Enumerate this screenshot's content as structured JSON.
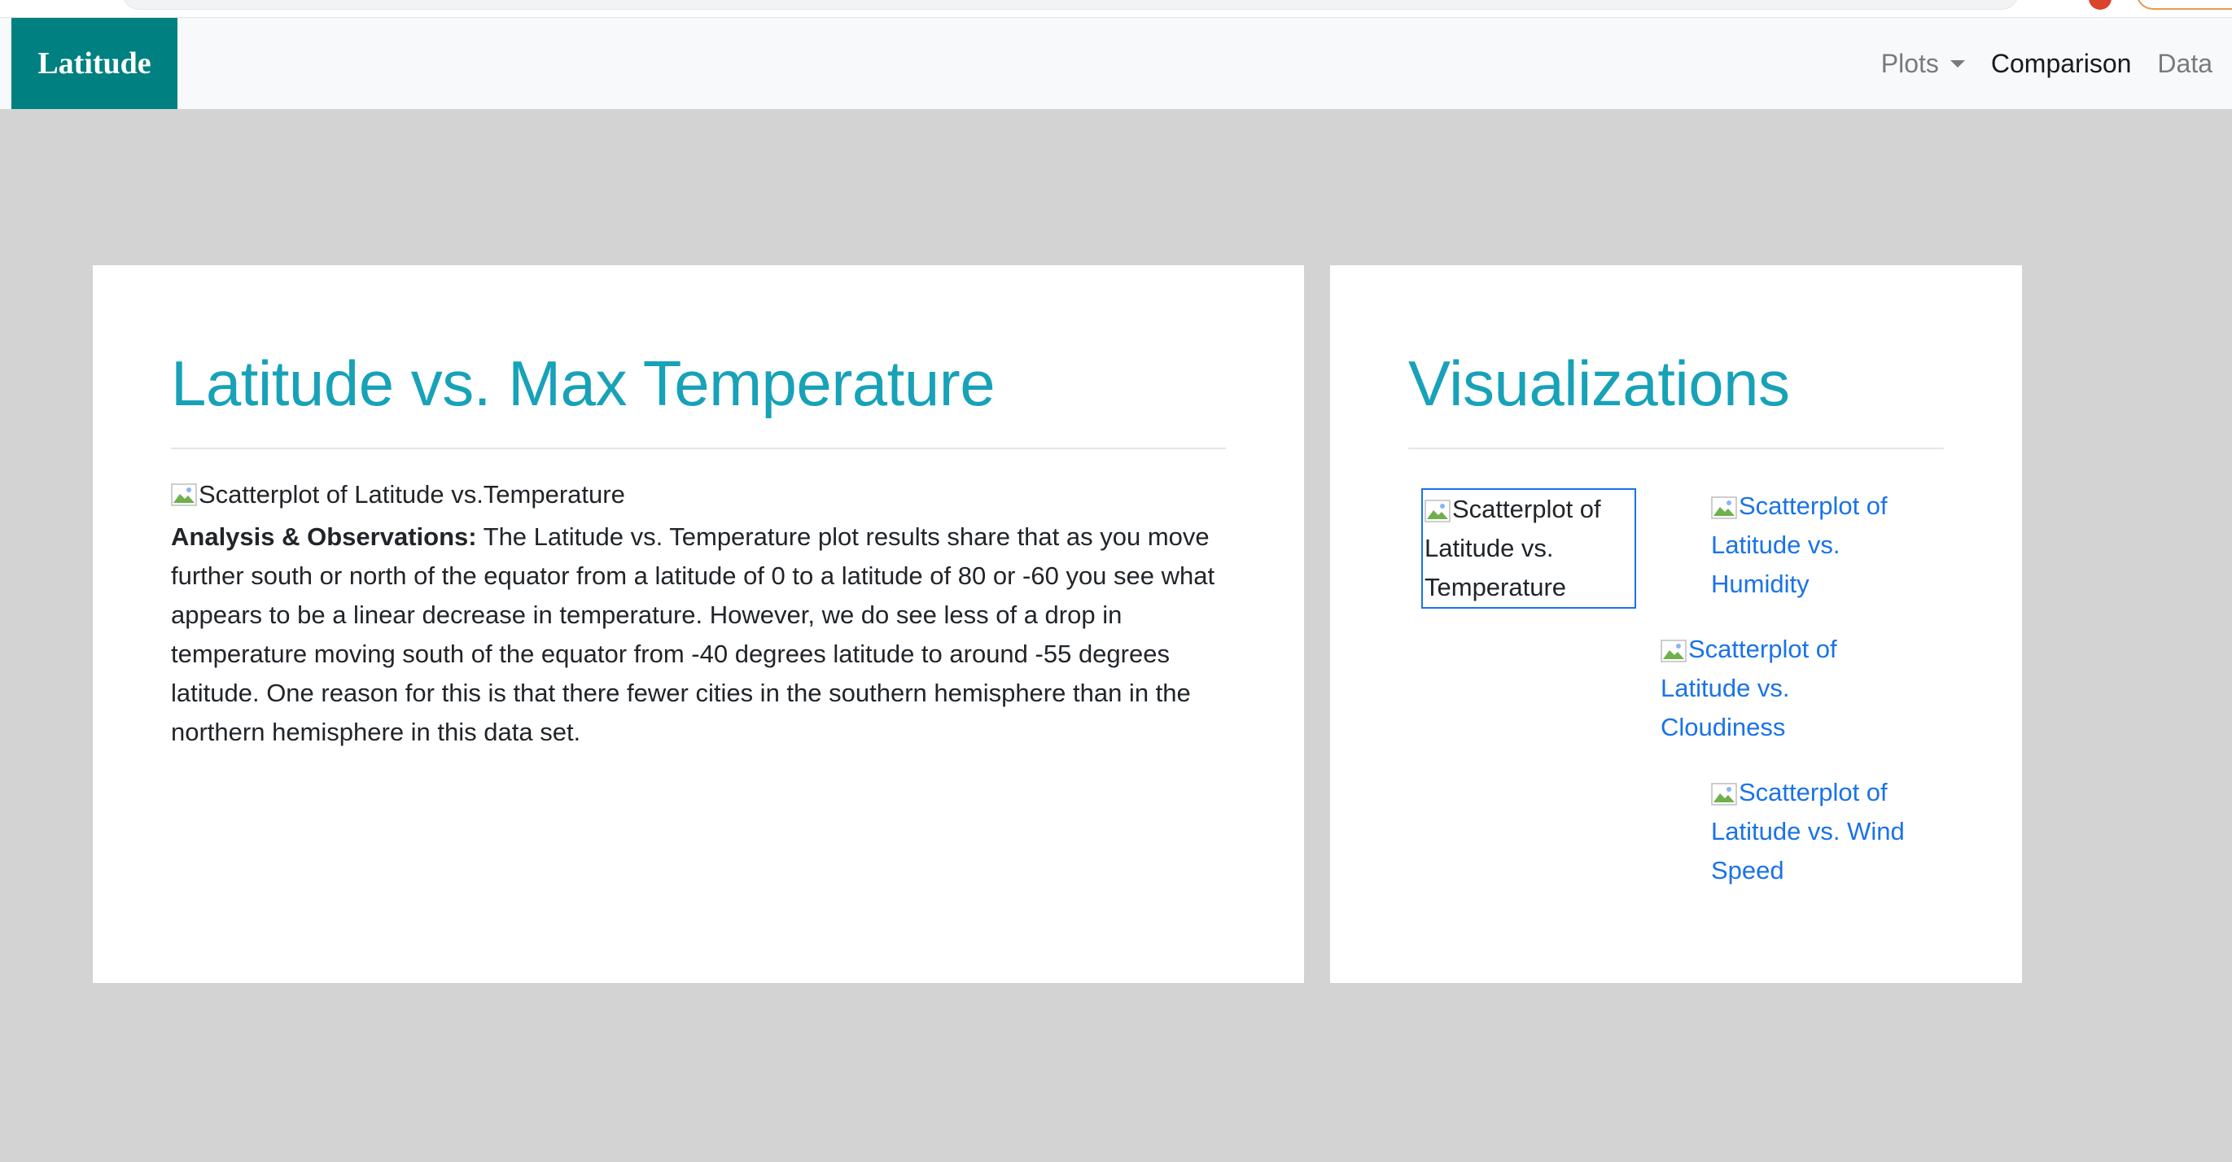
{
  "navbar": {
    "brand": "Latitude",
    "links": {
      "plots": "Plots",
      "comparison": "Comparison",
      "data": "Data"
    }
  },
  "main": {
    "title": "Latitude vs. Max Temperature",
    "image_alt": "Scatterplot of Latitude vs.Temperature",
    "analysis_label": "Analysis & Observations:",
    "analysis_text": " The Latitude vs. Temperature plot results share that as you move further south or north of the equator from a latitude of 0 to a latitude of 80 or -60 you see what appears to be a linear decrease in temperature. However, we do see less of a drop in temperature moving south of the equator from -40 degrees latitude to around -55 degrees latitude. One reason for this is that there fewer cities in the southern hemisphere than in the northern hemisphere in this data set."
  },
  "sidebar": {
    "title": "Visualizations",
    "thumbnails": [
      {
        "alt": "Scatterplot of Latitude vs. Temperature"
      },
      {
        "alt": "Scatterplot of Latitude vs. Humidity"
      },
      {
        "alt": "Scatterplot of Latitude vs. Cloudiness"
      },
      {
        "alt": "Scatterplot of Latitude vs. Wind Speed"
      }
    ]
  },
  "colors": {
    "brand_bg": "#008080",
    "title": "#17a2b8",
    "link": "#1a73e8",
    "page_bg": "#d3d3d3"
  }
}
